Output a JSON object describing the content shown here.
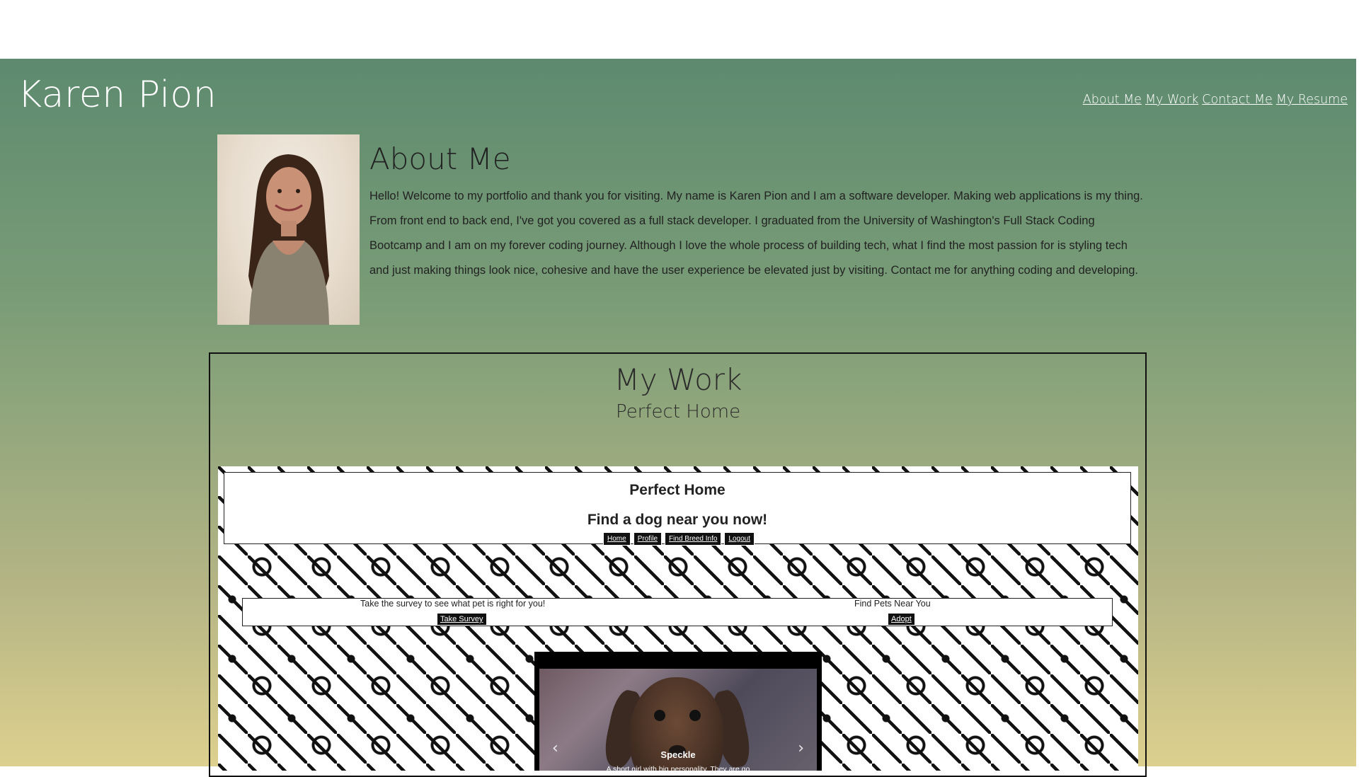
{
  "header": {
    "site_name": "Karen Pion",
    "nav": [
      "About Me",
      "My Work",
      "Contact Me",
      "My Resume"
    ]
  },
  "about": {
    "title": "About Me",
    "body": "Hello! Welcome to my portfolio and thank you for visiting. My name is Karen Pion and I am a software developer. Making web applications is my thing. From front end to back end, I've got you covered as a full stack developer. I graduated from the University of Washington's Full Stack Coding Bootcamp and I am on my forever coding journey. Although I love the whole process of building tech, what I find the most passion for is styling tech and just making things look nice, cohesive and have the user experience be elevated just by visiting. Contact me for anything coding and developing."
  },
  "work": {
    "title": "My Work",
    "project_title": "Perfect Home",
    "screenshot": {
      "title": "Perfect Home",
      "tagline": "Find a dog near you now!",
      "nav": [
        "Home",
        "Profile",
        "Find Breed Info",
        "Logout"
      ],
      "survey_text": "Take the survey to see what pet is right for you!",
      "survey_button": "Take Survey",
      "adopt_text": "Find Pets Near You",
      "adopt_button": "Adopt",
      "carousel_name": "Speckle",
      "carousel_desc": "A short girl with big personality. They are go",
      "prev_icon": "‹",
      "next_icon": "›"
    }
  },
  "colors": {
    "gradient_top": "#5d8a6f",
    "gradient_bottom": "#ddd08e"
  }
}
